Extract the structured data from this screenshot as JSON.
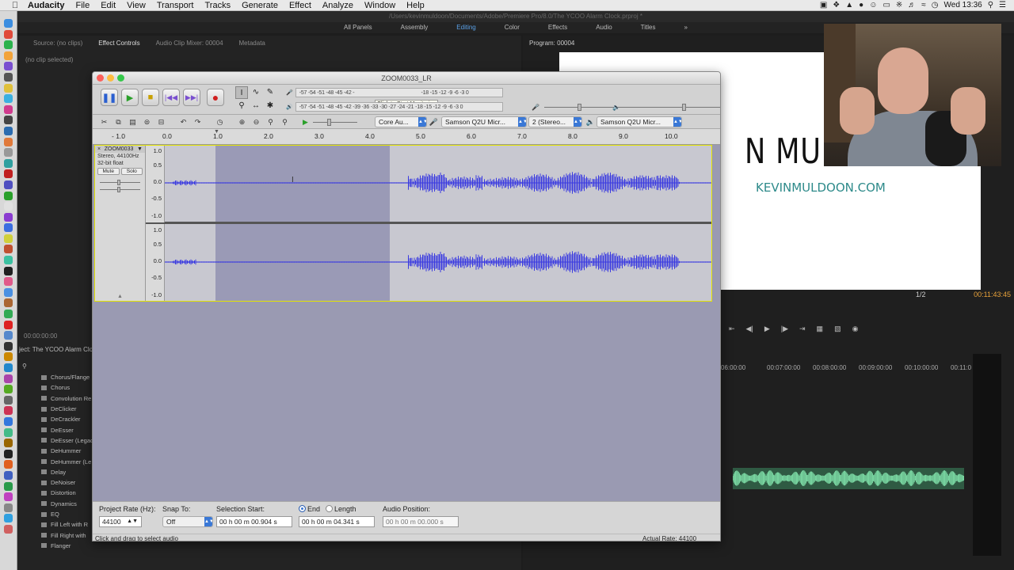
{
  "menubar": {
    "app": "Audacity",
    "items": [
      "File",
      "Edit",
      "View",
      "Transport",
      "Tracks",
      "Generate",
      "Effect",
      "Analyze",
      "Window",
      "Help"
    ],
    "clock": "Wed 13:36"
  },
  "premiere": {
    "title_path": "/Users/kevinmuldoon/Documents/Adobe/Premiere Pro/8.0/The YCOO Alarm Clock.prproj *",
    "workspaces": [
      "All Panels",
      "Assembly",
      "Editing",
      "Color",
      "Effects",
      "Audio",
      "Titles"
    ],
    "active_workspace": "Editing",
    "source_tabs": [
      "Source: (no clips)",
      "Effect Controls",
      "Audio Clip Mixer: 00004",
      "Metadata"
    ],
    "active_source_tab": "Effect Controls",
    "no_clip": "(no clip selected)",
    "left_timecode": "00:00:00:00",
    "project_label": "ject: The YCOO Alarm Clo",
    "effects_list": [
      "Chorus/Flange",
      "Chorus",
      "Convolution Re",
      "DeClicker",
      "DeCrackler",
      "DeEsser",
      "DeEsser (Legac",
      "DeHummer",
      "DeHummer (Le",
      "Delay",
      "DeNoiser",
      "Distortion",
      "Dynamics",
      "EQ",
      "Fill Left with R",
      "Fill Right with",
      "Flanger"
    ],
    "program_label": "Program: 00004",
    "video_name": "N MULDOON",
    "video_url": "KEVINMULDOON.COM",
    "resolution": "1/2",
    "program_timecode": "00:11:43:45",
    "timeline_ruler": [
      "06:00:00",
      "00:07:00:00",
      "00:08:00:00",
      "00:09:00:00",
      "00:10:00:00",
      "00:11:0"
    ]
  },
  "audacity": {
    "window_title": "ZOOM0033_LR",
    "tooltip": "Click to Start Monitoring",
    "meter_scale": "-57 -54 -51 -48 -45 -42 -",
    "meter_scale_right": "-18 -15 -12 -9 -6 -3 0",
    "meter_scale2": "-57 -54 -51 -48 -45 -42 -39 -36 -33 -30 -27 -24 -21 -18 -15 -12 -9 -6 -3 0",
    "device_host": "Core Au...",
    "device_input": "Samson Q2U Micr...",
    "device_channels": "2 (Stereo...",
    "device_output": "Samson Q2U Micr...",
    "ruler_ticks": [
      "- 1.0",
      "0.0",
      "1.0",
      "2.0",
      "3.0",
      "4.0",
      "5.0",
      "6.0",
      "7.0",
      "8.0",
      "9.0",
      "10.0"
    ],
    "track": {
      "name": "ZOOM0033",
      "info1": "Stereo, 44100Hz",
      "info2": "32-bit float",
      "mute": "Mute",
      "solo": "Solo",
      "scale": [
        "1.0",
        "0.5",
        "0.0",
        "-0.5",
        "-1.0"
      ]
    },
    "status": {
      "project_rate_label": "Project Rate (Hz):",
      "project_rate": "44100",
      "snap_label": "Snap To:",
      "snap_value": "Off",
      "selection_start_label": "Selection Start:",
      "end_label": "End",
      "length_label": "Length",
      "audio_position_label": "Audio Position:",
      "selection_start": "00 h 00 m 00.904 s",
      "selection_end": "00 h 00 m 04.341 s",
      "audio_position": "00 h 00 m 00.000 s",
      "hint": "Click and drag to select audio",
      "actual_rate": "Actual Rate: 44100"
    }
  }
}
